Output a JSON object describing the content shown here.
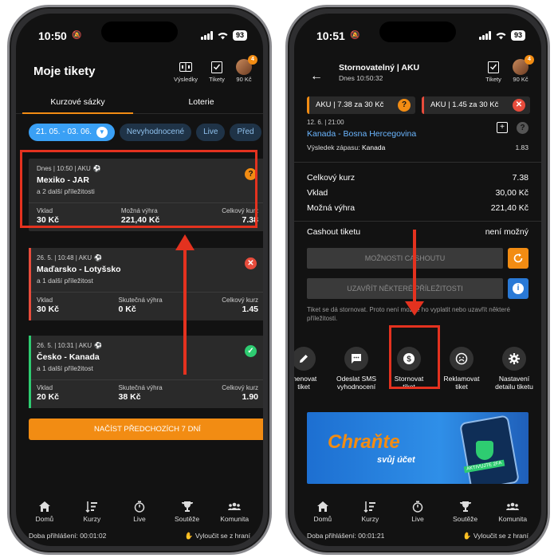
{
  "left_phone": {
    "status_time": "10:50",
    "battery": "93",
    "header_title": "Moje tikety",
    "header_icons": [
      {
        "label": "Výsledky",
        "icon": "results-icon"
      },
      {
        "label": "Tikety",
        "icon": "tickets-icon"
      },
      {
        "label": "90 Kč",
        "icon": "avatar"
      }
    ],
    "avatar_badge": "4",
    "tabs": [
      "Kurzové sázky",
      "Loterie"
    ],
    "chips": [
      "21. 05. - 03. 06.",
      "Nevyhodnocené",
      "Live",
      "Před"
    ],
    "tickets": [
      {
        "meta": "Dnes | 10:50 | AKU",
        "match": "Mexiko - JAR",
        "more": "a 2 další příležitosti",
        "labels": [
          "Vklad",
          "Možná výhra",
          "Celkový kurz"
        ],
        "values": [
          "30 Kč",
          "221,40 Kč",
          "7.38"
        ],
        "status": "pending",
        "status_glyph": "?"
      },
      {
        "meta": "26. 5. | 10:48 | AKU",
        "match": "Maďarsko - Lotyšsko",
        "more": "a 1 další příležitost",
        "labels": [
          "Vklad",
          "Skutečná výhra",
          "Celkový kurz"
        ],
        "values": [
          "30 Kč",
          "0 Kč",
          "1.45"
        ],
        "status": "lost",
        "status_glyph": "✕"
      },
      {
        "meta": "26. 5. | 10:31 | AKU",
        "match": "Česko - Kanada",
        "more": "a 1 další příležitost",
        "labels": [
          "Vklad",
          "Skutečná výhra",
          "Celkový kurz"
        ],
        "values": [
          "20 Kč",
          "38 Kč",
          "1.90"
        ],
        "status": "won",
        "status_glyph": "✓"
      }
    ],
    "load_button": "NAČÍST PŘEDCHOZÍCH 7 DNÍ",
    "footer_left": "Doba přihlášení: 00:01:02",
    "footer_right": "Vyloučit se z hraní"
  },
  "bottom_nav": [
    "Domů",
    "Kurzy",
    "Live",
    "Soutěže",
    "Komunita"
  ],
  "right_phone": {
    "status_time": "10:51",
    "battery": "93",
    "title": "Stornovatelný | AKU",
    "subtitle": "Dnes 10:50:32",
    "tiket_label": "Tikety",
    "avatar_label": "90 Kč",
    "avatar_badge": "4",
    "acc_tabs": [
      {
        "label": "AKU | 7.38 za 30 Kč",
        "status_glyph": "?"
      },
      {
        "label": "AKU | 1.45 za 30 Kč",
        "status_glyph": "✕"
      }
    ],
    "match_when": "12. 6. | 21:00",
    "match_name": "Kanada - Bosna Hercegovina",
    "result_label": "Výsledek zápasu:",
    "result_value": "Kanada",
    "result_odds": "1.83",
    "summary": [
      {
        "label": "Celkový kurz",
        "value": "7.38"
      },
      {
        "label": "Vklad",
        "value": "30,00 Kč"
      },
      {
        "label": "Možná výhra",
        "value": "221,40 Kč"
      }
    ],
    "cashout_label": "Cashout tiketu",
    "cashout_value": "není možný",
    "cashout_options_button": "MOŽNOSTI CASHOUTU",
    "close_opportunities_button": "UZAVŘÍT NĚKTERÉ PŘÍLEŽITOSTI",
    "note": "Tiket se dá stornovat. Proto není možné ho vyplatit nebo uzavřít některé příležitosti.",
    "actions": [
      {
        "label": "menovat\ntiket",
        "icon": "pencil-icon"
      },
      {
        "label": "Odeslat SMS\nvyhodnocení",
        "icon": "sms-icon"
      },
      {
        "label": "Stornovat\ntiket",
        "icon": "storno-icon"
      },
      {
        "label": "Reklamovat\ntiket",
        "icon": "complaint-icon"
      },
      {
        "label": "Nastavení\ndetailu tiketu",
        "icon": "gear-icon"
      }
    ],
    "banner_title": "Chraňte",
    "banner_sub": "svůj účet",
    "banner_tag": "AKTIVUJTE 2FA",
    "footer_left": "Doba přihlášení: 00:01:21",
    "footer_right": "Vyloučit se z hraní"
  },
  "colors": {
    "accent_orange": "#f28c13",
    "link_blue": "#6bb6ff",
    "chip_blue": "#3aa0f5",
    "lost_red": "#e74c3c",
    "won_green": "#2ecc71",
    "annotation_red": "#e4321f"
  }
}
